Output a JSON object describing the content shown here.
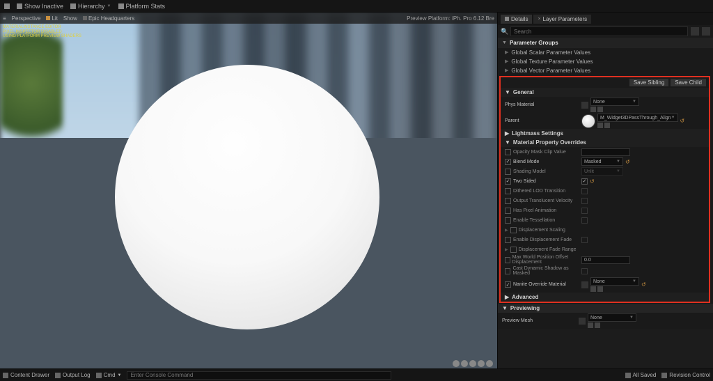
{
  "topbar": {
    "save_icon": "save",
    "show_inactive": "Show Inactive",
    "hierarchy": "Hierarchy",
    "platform_stats": "Platform Stats"
  },
  "viewport": {
    "menu": "≡",
    "perspective": "Perspective",
    "lit": "Lit",
    "show": "Show",
    "scene": "Epic Headquarters",
    "preview_platform": "Preview Platform: iPh. Pro 6.12 Bre",
    "debug": "MATERIALINSTANCE EDITOR\nPIXEL INSPECTOR DISABLED\nUSING PLATFORM PREVIEW SHADERS"
  },
  "tabs": {
    "details": "Details",
    "layer_params": "Layer Parameters"
  },
  "search": {
    "placeholder": "Search"
  },
  "groups": {
    "header": "Parameter Groups",
    "items": [
      "Global Scalar Parameter Values",
      "Global Texture Parameter Values",
      "Global Vector Parameter Values"
    ]
  },
  "save_buttons": {
    "sibling": "Save Sibling",
    "child": "Save Child"
  },
  "general": {
    "header": "General",
    "phys_material": "Phys Material",
    "none": "None",
    "parent": "Parent",
    "parent_asset": "M_Widget3DPassThrough_Align"
  },
  "lightmass": {
    "header": "Lightmass Settings"
  },
  "mpo": {
    "header": "Material Property Overrides",
    "opacity_clip": "Opacity Mask Clip Value",
    "blend_mode": "Blend Mode",
    "blend_mode_val": "Masked",
    "shading_model": "Shading Model",
    "shading_model_val": "Unlit",
    "two_sided": "Two Sided",
    "dithered_lod": "Dithered LOD Transition",
    "output_velocity": "Output Translucent Velocity",
    "has_pixel_anim": "Has Pixel Animation",
    "enable_tess": "Enable Tessellation",
    "displacement_scaling": "Displacement Scaling",
    "enable_disp_fade": "Enable Displacement Fade",
    "displacement_fade": "Displacement Fade Range",
    "max_wpo": "Max World Position Offset Displacement",
    "max_wpo_val": "0.0",
    "cast_dynamic": "Cast Dynamic Shadow as Masked",
    "nanite_override": "Nanite Override Material",
    "nanite_val": "None"
  },
  "advanced": {
    "header": "Advanced"
  },
  "previewing": {
    "header": "Previewing",
    "preview_mesh": "Preview Mesh",
    "preview_mesh_val": "None"
  },
  "bottombar": {
    "content_drawer": "Content Drawer",
    "output_log": "Output Log",
    "cmd_label": "Cmd",
    "cmd_placeholder": "Enter Console Command",
    "all_saved": "All Saved",
    "revision": "Revision Control"
  }
}
